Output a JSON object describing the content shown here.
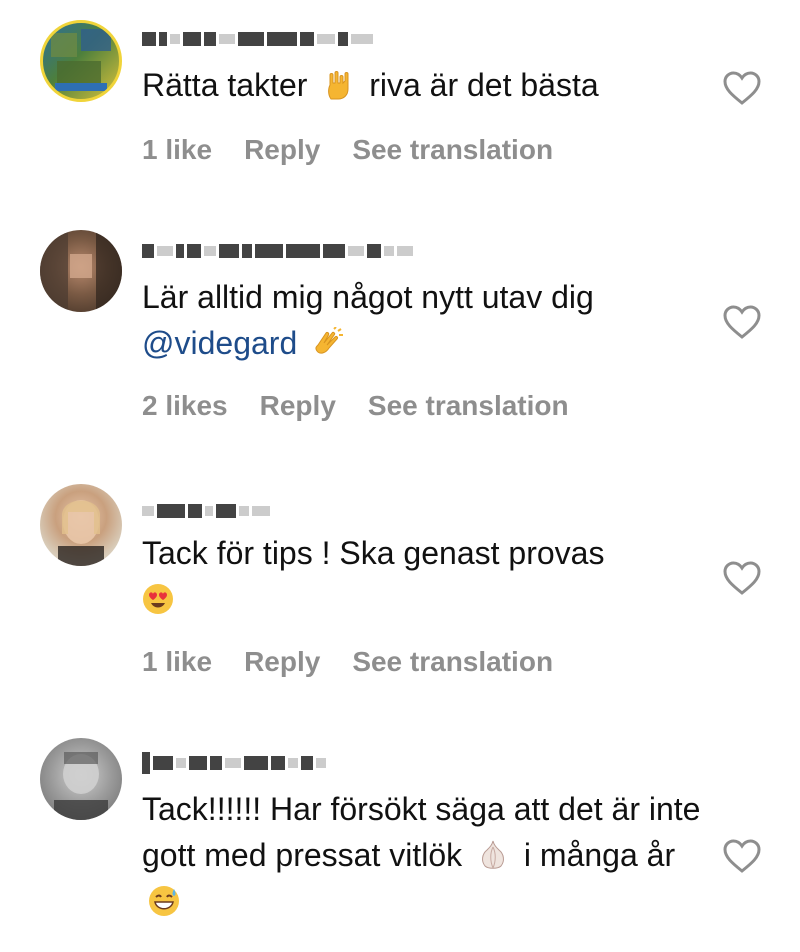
{
  "comments": [
    {
      "text": "Rätta takter",
      "text_after": "riva är det bästa",
      "emoji_mid": "rock-on-hand",
      "likes_label": "1 like",
      "reply_label": "Reply",
      "translate_label": "See translation"
    },
    {
      "text": "Lär alltid mig något nytt utav dig",
      "mention": "@videgard",
      "emoji_end": "clapping-hands",
      "likes_label": "2 likes",
      "reply_label": "Reply",
      "translate_label": "See translation"
    },
    {
      "text": "Tack för tips ! Ska genast provas",
      "emoji_end": "heart-eyes-face",
      "likes_label": "1 like",
      "reply_label": "Reply",
      "translate_label": "See translation"
    },
    {
      "text": "Tack!!!!!! Har försökt säga att det är inte gott med pressat vitlök",
      "text_after": "i många år",
      "emoji_mid": "garlic",
      "emoji_end": "grinning-sweat-face"
    }
  ],
  "colors": {
    "text": "#111111",
    "meta": "#8e8e8e",
    "mention": "#1e4c8a"
  }
}
